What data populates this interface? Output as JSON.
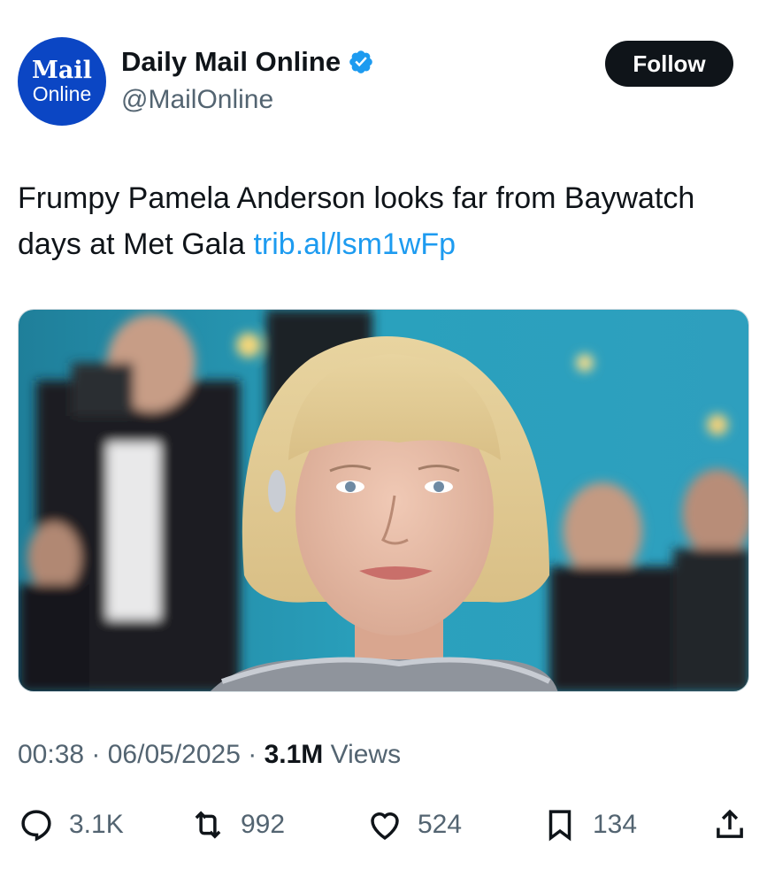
{
  "account": {
    "avatar_line1": "Mail",
    "avatar_line2": "Online",
    "display_name": "Daily Mail Online",
    "handle": "@MailOnline",
    "verified_icon": "verified-badge-icon"
  },
  "follow_label": "Follow",
  "tweet": {
    "text": "Frumpy Pamela Anderson looks far from Baywatch days at Met Gala ",
    "link": "trib.al/lsm1wFp"
  },
  "media": {
    "description_icon": "photo"
  },
  "meta": {
    "time": "00:38",
    "separator": " · ",
    "date": "06/05/2025",
    "views_count": "3.1M",
    "views_label": " Views"
  },
  "actions": {
    "replies": "3.1K",
    "reposts": "992",
    "likes": "524",
    "bookmarks": "134"
  },
  "colors": {
    "accent": "#1d9bf0",
    "brand": "#0b46c4",
    "text": "#0f1419",
    "secondary": "#536471"
  }
}
